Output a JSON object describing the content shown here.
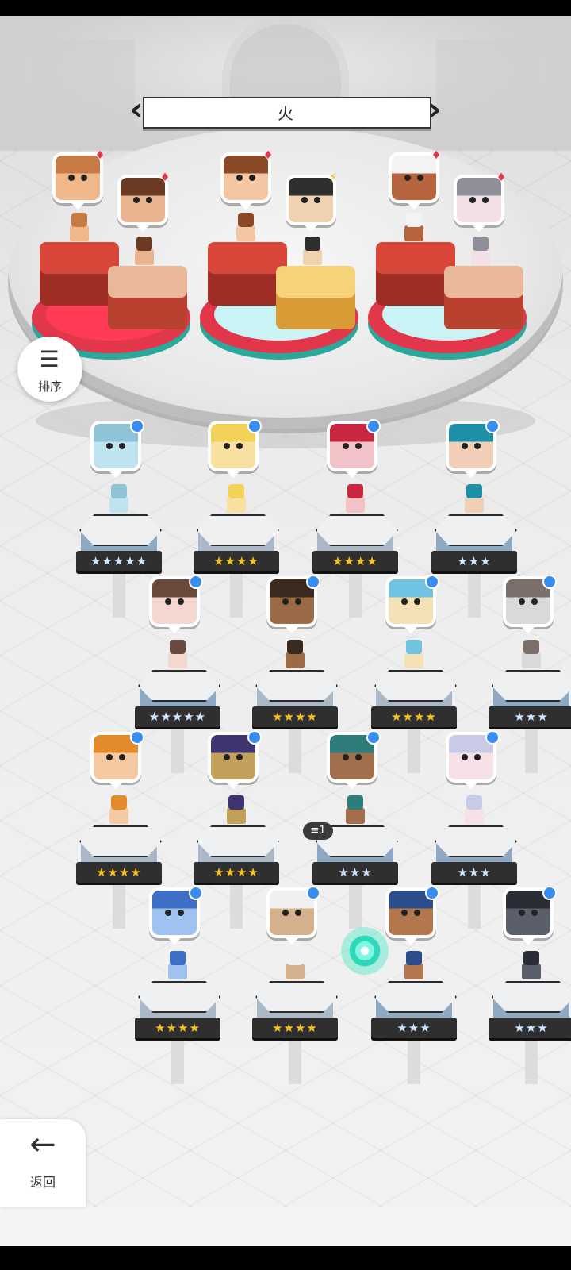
{
  "element_selector": {
    "label": "火",
    "prev_icon": "chevron-left-icon",
    "next_icon": "chevron-right-icon"
  },
  "sort_button": {
    "label": "排序",
    "icon": "sort-descending-icon"
  },
  "back_button": {
    "label": "返回",
    "icon": "arrow-left-icon"
  },
  "hero_counter": {
    "text": "1",
    "icon": "stack-icon"
  },
  "team": [
    {
      "portrait_color": "#f0b78b",
      "hair": "#c77a45",
      "element": "fire"
    },
    {
      "portrait_color": "#e8b48f",
      "hair": "#6a3a22",
      "element": "fire"
    },
    {
      "portrait_color": "#f3c7a3",
      "hair": "#8a4a28",
      "element": "fire"
    },
    {
      "portrait_color": "#f1d2b0",
      "hair": "#2f2f2f",
      "element": "lightning"
    },
    {
      "portrait_color": "#b5643e",
      "hair": "#f3f3f3",
      "element": "fire"
    },
    {
      "portrait_color": "#f2e0e6",
      "hair": "#8f8f99",
      "element": "fire"
    }
  ],
  "roster": [
    {
      "stars": "★★★★★",
      "tier": "silver",
      "color": "#bfe3ef",
      "hair": "#8ec3d6"
    },
    {
      "stars": "★★★★",
      "tier": "gold",
      "color": "#f8e0a0",
      "hair": "#f3d25a"
    },
    {
      "stars": "★★★★",
      "tier": "gold",
      "color": "#f2c3c6",
      "hair": "#c8283f"
    },
    {
      "stars": "★★★",
      "tier": "silver",
      "color": "#f1cfb7",
      "hair": "#1f8fa6"
    },
    {
      "stars": "★★★★★",
      "tier": "silver",
      "color": "#f3d7d0",
      "hair": "#6b4a3e"
    },
    {
      "stars": "★★★★",
      "tier": "gold",
      "color": "#9b6a46",
      "hair": "#3b2a1e"
    },
    {
      "stars": "★★★★",
      "tier": "gold",
      "color": "#f4e2b6",
      "hair": "#6fc3e0"
    },
    {
      "stars": "★★★",
      "tier": "silver",
      "color": "#d9d9d9",
      "hair": "#7a6f6a"
    },
    {
      "stars": "★★★★",
      "tier": "gold",
      "color": "#f5c9a1",
      "hair": "#e38b2c"
    },
    {
      "stars": "★★★★",
      "tier": "gold",
      "color": "#c2a05a",
      "hair": "#3e3470"
    },
    {
      "stars": "★★★",
      "tier": "silver",
      "color": "#a26f4c",
      "hair": "#2e7d7a"
    },
    {
      "stars": "★★★",
      "tier": "silver",
      "color": "#f6e1e6",
      "hair": "#c9c9e8"
    },
    {
      "stars": "★★★★",
      "tier": "gold",
      "color": "#9fc2f0",
      "hair": "#3d6fc7"
    },
    {
      "stars": "★★★★",
      "tier": "gold",
      "color": "#d4b08c",
      "hair": "#f0f0f0"
    },
    {
      "stars": "★★★",
      "tier": "silver",
      "color": "#b3764f",
      "hair": "#2b4d8a"
    },
    {
      "stars": "★★★",
      "tier": "silver",
      "color": "#5b5f6b",
      "hair": "#2b2d36"
    }
  ]
}
